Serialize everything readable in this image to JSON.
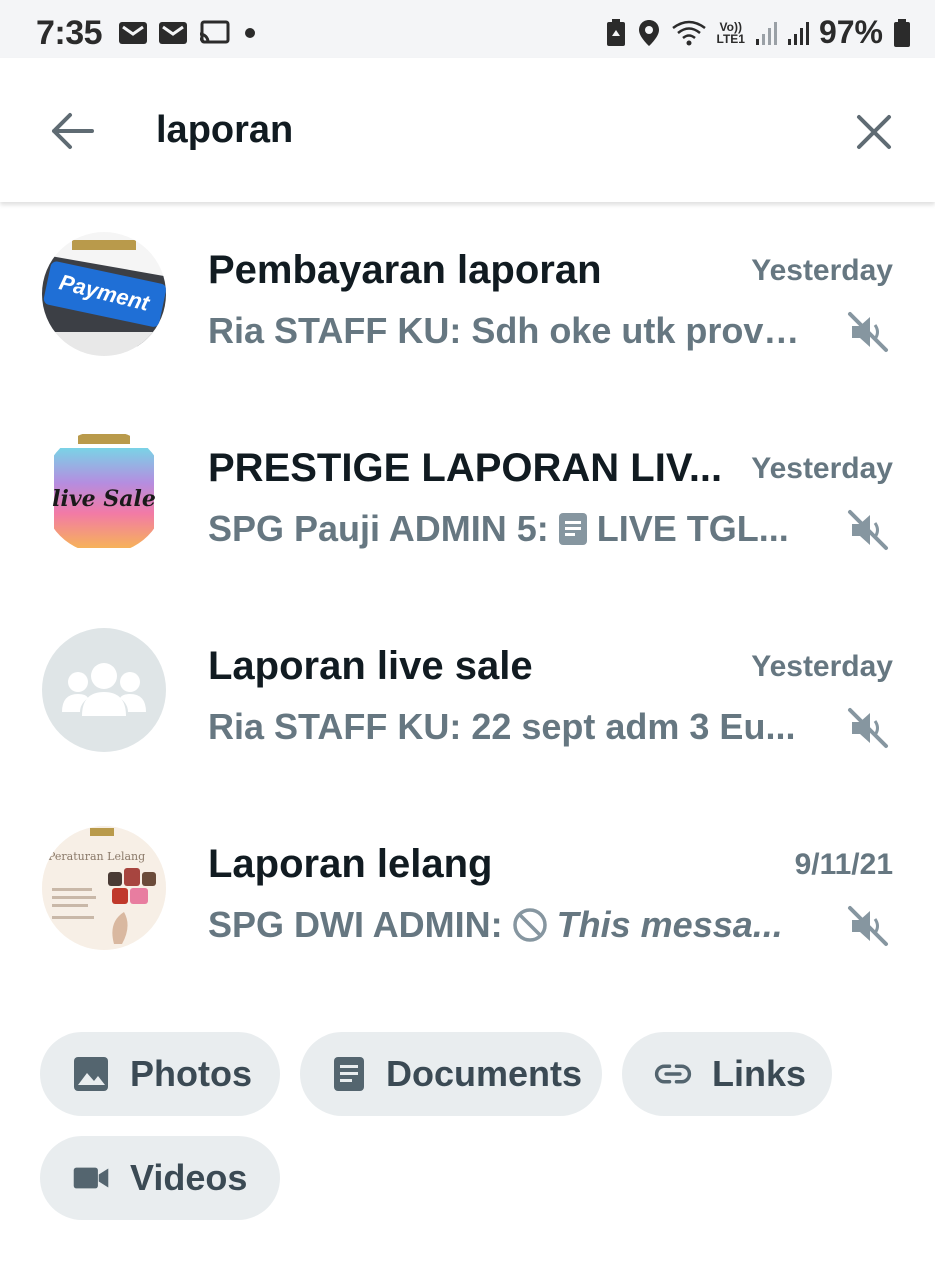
{
  "status_bar": {
    "time": "7:35",
    "battery": "97%",
    "network_top": "Vo))",
    "network_bottom": "LTE1",
    "left_icons": [
      "mail-icon",
      "mail-icon",
      "cast-icon",
      "dot-icon"
    ],
    "right_icons": [
      "battery-saver-icon",
      "location-icon",
      "wifi-icon",
      "signal-icon",
      "signal-icon",
      "battery-icon"
    ]
  },
  "search": {
    "query": "laporan",
    "back_icon": "arrow-left-icon",
    "clear_icon": "close-icon"
  },
  "results": [
    {
      "title": "Pembayaran laporan",
      "time": "Yesterday",
      "preview": "Ria STAFF KU: Sdh oke utk provit...",
      "muted": true,
      "avatar": "payment-keyboard-image"
    },
    {
      "title": "PRESTIGE LAPORAN LIV...",
      "time": "Yesterday",
      "preview_sender": "SPG Pauji ADMIN 5:",
      "preview_icon": "document-icon",
      "preview": "LIVE TGL...",
      "muted": true,
      "avatar": "live-sale-image",
      "avatar_text": "live Sale"
    },
    {
      "title": "Laporan live sale",
      "time": "Yesterday",
      "preview": "Ria STAFF KU: 22 sept adm 3 Eu...",
      "muted": true,
      "avatar": "group-icon"
    },
    {
      "title": "Laporan lelang",
      "time": "9/11/21",
      "preview_sender": "SPG DWI ADMIN:",
      "preview_icon": "blocked-icon",
      "preview": "This messa...",
      "muted": true,
      "avatar": "peraturan-lelang-image",
      "avatar_text": "Peraturan Lelang"
    }
  ],
  "filters": [
    {
      "label": "Photos",
      "icon": "photo-icon"
    },
    {
      "label": "Documents",
      "icon": "document-icon"
    },
    {
      "label": "Links",
      "icon": "link-icon"
    },
    {
      "label": "Videos",
      "icon": "video-icon"
    }
  ],
  "colors": {
    "secondary_text": "#667781",
    "chip_bg": "#e9edef",
    "avatar_placeholder": "#dfe5e7"
  }
}
